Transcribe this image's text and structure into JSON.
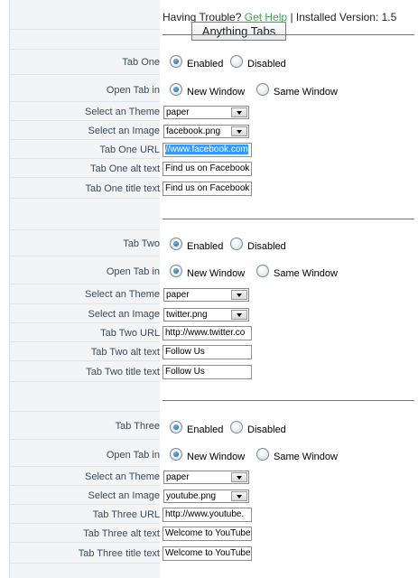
{
  "header": {
    "trouble_text": "Having Trouble?",
    "help_link": "Get Help",
    "separator": "|",
    "version_text": "Installed Version: 1.5",
    "tooltip": "Anything Tabs"
  },
  "radio_labels": {
    "enabled": "Enabled",
    "disabled": "Disabled",
    "new_window": "New Window",
    "same_window": "Same Window"
  },
  "tab1": {
    "label_tab": "Tab One",
    "label_open": "Open Tab in",
    "label_theme": "Select an Theme",
    "label_image": "Select an Image",
    "label_url": "Tab One URL",
    "label_alt": "Tab One alt text",
    "label_title": "Tab One title text",
    "theme_value": "paper",
    "image_value": "facebook.png",
    "url_value": "//www.facebook.com",
    "alt_value": "Find us on Facebook",
    "title_value": "Find us on Facebook"
  },
  "tab2": {
    "label_tab": "Tab Two",
    "label_open": "Open Tab in",
    "label_theme": "Select an Theme",
    "label_image": "Select an Image",
    "label_url": "Tab Two URL",
    "label_alt": "Tab Two alt text",
    "label_title": "Tab Two title text",
    "theme_value": "paper",
    "image_value": "twitter.png",
    "url_value": "http://www.twitter.co",
    "alt_value": "Follow Us",
    "title_value": "Follow Us"
  },
  "tab3": {
    "label_tab": "Tab Three",
    "label_open": "Open Tab in",
    "label_theme": "Select an Theme",
    "label_image": "Select an Image",
    "label_url": "Tab Three URL",
    "label_alt": "Tab Three alt text",
    "label_title": "Tab Three title text",
    "theme_value": "paper",
    "image_value": "youtube.png",
    "url_value": "http://www.youtube.",
    "alt_value": "Welcome to YouTube",
    "title_value": "Welcome to YouTube"
  }
}
